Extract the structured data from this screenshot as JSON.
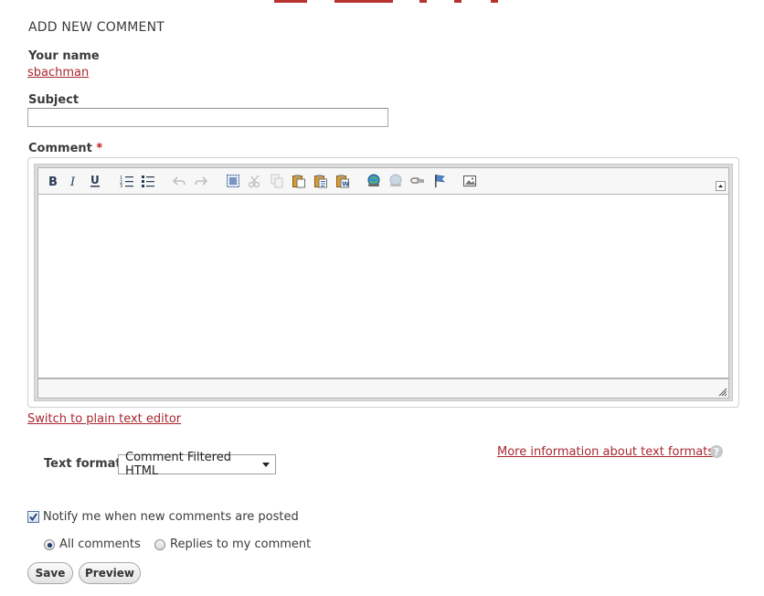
{
  "section_title": "ADD NEW COMMENT",
  "name": {
    "label": "Your name",
    "value": "sbachman"
  },
  "subject": {
    "label": "Subject",
    "value": ""
  },
  "comment": {
    "label": "Comment",
    "required_marker": "*"
  },
  "toolbar": {
    "icons": [
      "bold-icon",
      "italic-icon",
      "underline-icon",
      "ordered-list-icon",
      "bulleted-list-icon",
      "undo-icon",
      "redo-icon",
      "select-all-icon",
      "cut-icon",
      "copy-icon",
      "paste-icon",
      "paste-text-icon",
      "paste-word-icon",
      "link-icon",
      "unlink-icon",
      "anchor-icon",
      "flag-icon",
      "image-icon"
    ]
  },
  "switch_editor_link": "Switch to plain text editor",
  "text_format": {
    "label": "Text format",
    "selected": "Comment Filtered HTML"
  },
  "more_info_link": "More information about text formats",
  "help_glyph": "?",
  "notify": {
    "label": "Notify me when new comments are posted",
    "checked": true
  },
  "notify_options": [
    {
      "label": "All comments",
      "selected": true
    },
    {
      "label": "Replies to my comment",
      "selected": false
    }
  ],
  "buttons": {
    "save": "Save",
    "preview": "Preview"
  },
  "colors": {
    "link": "#a9272f",
    "required": "#c41a1a",
    "accent": "#b8322f"
  }
}
